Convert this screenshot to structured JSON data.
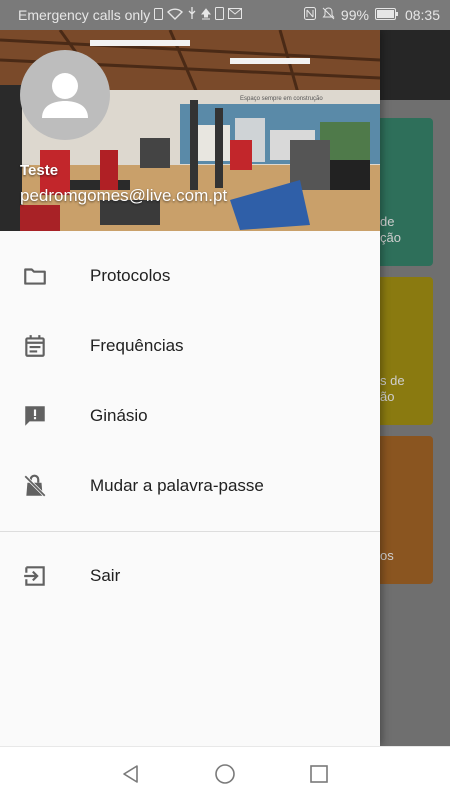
{
  "status_bar": {
    "carrier_text": "Emergency calls only",
    "battery": "99%",
    "time": "08:35",
    "icons": [
      "sim-icon",
      "wifi-icon",
      "usb-icon",
      "upload-icon",
      "phone-icon",
      "mail-icon",
      "nfc-icon",
      "mute-icon",
      "battery-icon"
    ]
  },
  "drawer": {
    "header": {
      "user_name": "Teste",
      "user_email": "pedromgomes@live.com.pt",
      "sign_text": "Espaço sempre em construção"
    },
    "menu_items": [
      {
        "label": "Protocolos",
        "icon": "folder-icon"
      },
      {
        "label": "Frequências",
        "icon": "calendar-icon"
      },
      {
        "label": "Ginásio",
        "icon": "feedback-icon"
      },
      {
        "label": "Mudar a palavra-passe",
        "icon": "lock-bag-icon"
      }
    ],
    "footer_items": [
      {
        "label": "Sair",
        "icon": "logout-icon"
      }
    ]
  },
  "background_cards": [
    {
      "text": "de\nção",
      "color": "#2e6f5a"
    },
    {
      "text": "s de\não",
      "color": "#8a7a10"
    },
    {
      "text": "os",
      "color": "#8a5520"
    }
  ],
  "colors": {
    "drawer_bg": "#fafafa",
    "scrim": "#6f6f6f",
    "icon": "#616161",
    "text": "#212121"
  }
}
